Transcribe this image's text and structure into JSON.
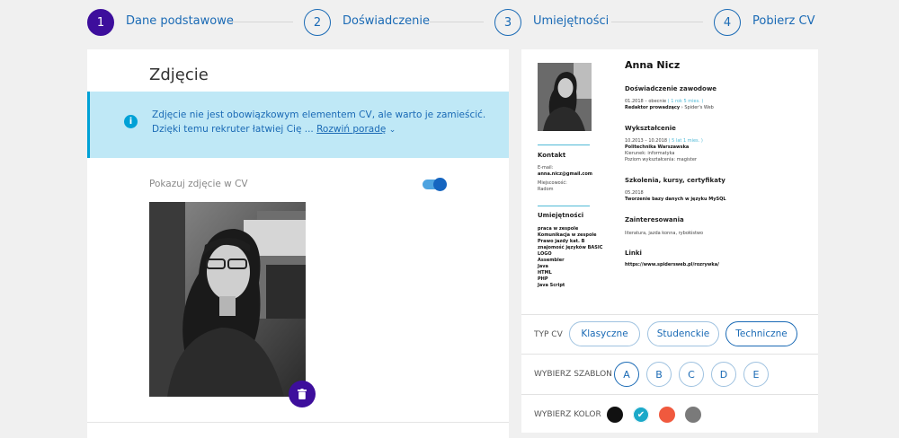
{
  "steps": [
    {
      "number": "1",
      "label": "Dane podstawowe"
    },
    {
      "number": "2",
      "label": "Doświadczenie"
    },
    {
      "number": "3",
      "label": "Umiejętności"
    },
    {
      "number": "4",
      "label": "Pobierz CV"
    }
  ],
  "photo_section": {
    "title": "Zdjęcie",
    "info_line1": "Zdjęcie nie jest obowiązkowym elementem CV, ale warto je zamieścić.",
    "info_line2": "Dzięki temu rekruter łatwiej Cię ...",
    "info_link": "Rozwiń poradę",
    "toggle_label": "Pokazuj zdjęcie w CV",
    "toggle_on": true
  },
  "cv_preview": {
    "name": "Anna Nicz",
    "contact_heading": "Kontakt",
    "email_label": "E-mail:",
    "email": "anna.nicz@gmail.com",
    "city_label": "Miejscowość:",
    "city": "Radom",
    "skills_heading": "Umiejętności",
    "skills": [
      "praca w zespole",
      "Komunikacja w zespole",
      "Prawo jazdy kat. B",
      "znajomość języków BASIC",
      "LOGO",
      "Assembler",
      "Java",
      "HTML",
      "PHP",
      "Java Script"
    ],
    "experience_heading": "Doświadczenie zawodowe",
    "experience_dates": "01.2018 – obecnie",
    "experience_duration": "( 1 rok 5 mies. )",
    "experience_role": "Redaktor prowadzący",
    "experience_company": "Spider's Web",
    "education_heading": "Wykształcenie",
    "education_dates": "10.2013 – 10.2018",
    "education_duration": "( 5 lat 1 mies. )",
    "education_school": "Politechnika Warszawska",
    "education_field": "Kierunek: informatyka",
    "education_level": "Poziom wykształcenia: magister",
    "training_heading": "Szkolenia, kursy, certyfikaty",
    "training_date": "05.2018",
    "training_name": "Tworzenie bazy danych w języku MySQL",
    "interests_heading": "Zainteresowania",
    "interests": "literatura, jazda konna, rybołóstwo",
    "links_heading": "Linki",
    "links": "https://www.spidersweb.pl/rozrywka/"
  },
  "cv_type": {
    "label": "TYP CV",
    "options": [
      "Klasyczne",
      "Studenckie",
      "Techniczne"
    ],
    "selected": "Techniczne"
  },
  "template": {
    "label": "WYBIERZ SZABLON",
    "options": [
      "A",
      "B",
      "C",
      "D",
      "E"
    ],
    "selected": "A"
  },
  "color": {
    "label": "WYBIERZ KOLOR",
    "options": [
      "#111111",
      "#1ba9c9",
      "#f0593e",
      "#7a7a7a"
    ],
    "selected_index": 1
  },
  "accent_color": "#3d0e9c",
  "link_color": "#1a6ab5"
}
